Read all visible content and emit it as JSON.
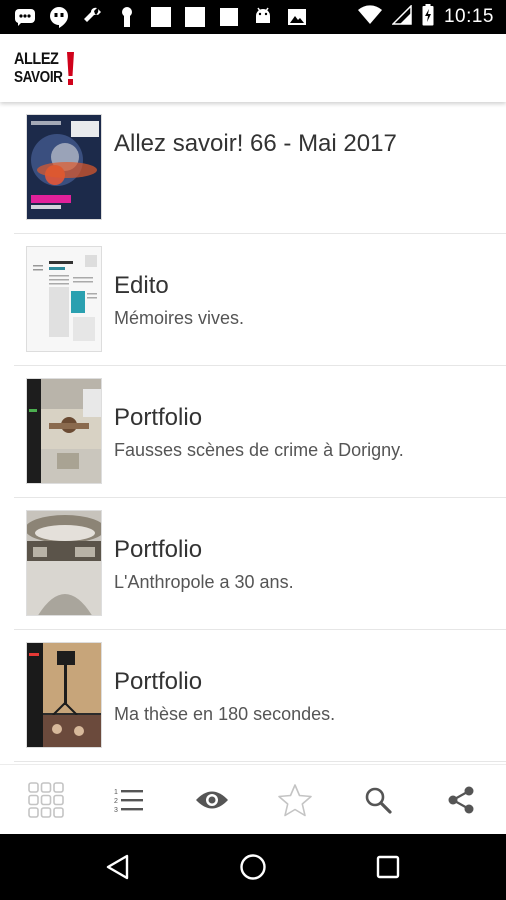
{
  "status_bar": {
    "time": "10:15",
    "left_icons": [
      "messages-icon",
      "hangouts-icon",
      "wrench-icon",
      "keyhole-icon",
      "blank-icon",
      "blank-icon",
      "blank-icon",
      "android-icon",
      "image-icon"
    ],
    "right_icons": [
      "wifi-icon",
      "signal-icon",
      "battery-icon"
    ]
  },
  "app_bar": {
    "logo_line1": "ALLEZ",
    "logo_line2": "SAVOIR",
    "logo_accent": "#d0021b"
  },
  "articles": [
    {
      "title": "Allez savoir! 66 - Mai 2017",
      "subtitle": "",
      "thumb": "cover"
    },
    {
      "title": "Edito",
      "subtitle": "Mémoires vives.",
      "thumb": "edito"
    },
    {
      "title": "Portfolio",
      "subtitle": "Fausses scènes de crime à Dorigny.",
      "thumb": "portfolio-crime"
    },
    {
      "title": "Portfolio",
      "subtitle": "L'Anthropole a 30 ans.",
      "thumb": "portfolio-anthropole"
    },
    {
      "title": "Portfolio",
      "subtitle": "Ma thèse en 180 secondes.",
      "thumb": "portfolio-these"
    }
  ],
  "toolbar": {
    "items": [
      "grid-icon",
      "list-icon",
      "eye-icon",
      "star-icon",
      "search-icon",
      "share-icon"
    ]
  },
  "nav_bar": {
    "items": [
      "back-icon",
      "home-icon",
      "recents-icon"
    ]
  },
  "colors": {
    "accent": "#d0021b",
    "text": "#333333",
    "subtext": "#555555",
    "toolbar_icon": "#bdbdbd",
    "toolbar_icon_dark": "#555555"
  }
}
